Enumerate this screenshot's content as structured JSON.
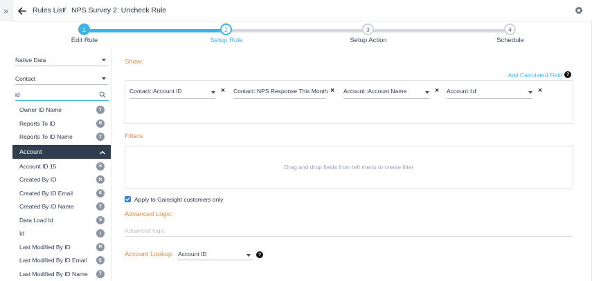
{
  "header": {
    "breadcrumb_root": "Rules List",
    "breadcrumb_separator": "/",
    "breadcrumb_current": "NPS Survey 2: Uncheck Rule",
    "expander_glyph": "»"
  },
  "stepper": {
    "steps": [
      {
        "number": "1",
        "label": "Edit Rule",
        "state": "done"
      },
      {
        "number": "2",
        "label": "Setup Rule",
        "state": "active"
      },
      {
        "number": "3",
        "label": "Setup Action",
        "state": "todo"
      },
      {
        "number": "4",
        "label": "Schedule",
        "state": "todo"
      }
    ]
  },
  "sidebar": {
    "source_select": "Native Data",
    "object_select": "Contact",
    "search_value": "id",
    "fields_before": [
      {
        "label": "Owner ID Name",
        "type": "T"
      },
      {
        "label": "Reports To ID",
        "type": "R"
      },
      {
        "label": "Reports To ID Name",
        "type": "T"
      }
    ],
    "group": {
      "label": "Account"
    },
    "fields_after": [
      {
        "label": "Account ID 15",
        "type": "S"
      },
      {
        "label": "Created By ID",
        "type": "R"
      },
      {
        "label": "Created By ID Email",
        "type": "E"
      },
      {
        "label": "Created By ID Name",
        "type": "T"
      },
      {
        "label": "Data Load Id",
        "type": "S"
      },
      {
        "label": "Id",
        "type": "I"
      },
      {
        "label": "Last Modified By ID",
        "type": "R"
      },
      {
        "label": "Last Modified By ID Email",
        "type": "E"
      },
      {
        "label": "Last Modified By ID Name",
        "type": "T"
      }
    ]
  },
  "main": {
    "show_title": "Show:",
    "add_calculated_field": "Add Calculated Field",
    "help_glyph": "?",
    "show_fields": [
      {
        "label": "Contact::Account ID",
        "has_dropdown": true
      },
      {
        "label": "Contact::NPS Response This Month",
        "has_dropdown": false
      },
      {
        "label": "Account::Account Name",
        "has_dropdown": true
      },
      {
        "label": "Account::Id",
        "has_dropdown": true
      }
    ],
    "remove_glyph": "×",
    "filters_title": "Filters:",
    "filters_placeholder": "Drag and drop fields from left menu to create filter",
    "apply_label": "Apply to Gainsight customers only",
    "advanced_logic_title": "Advanced Logic:",
    "advanced_logic_placeholder": "Advanced logic",
    "account_lookup_title": "Account Lookup:",
    "account_lookup_value": "Account ID"
  },
  "colors": {
    "accent": "#3fb4e3",
    "section_title": "#f08843",
    "group_header": "#2f3d4f",
    "badge": "#8c96a3",
    "checkbox": "#3f7fd9"
  }
}
